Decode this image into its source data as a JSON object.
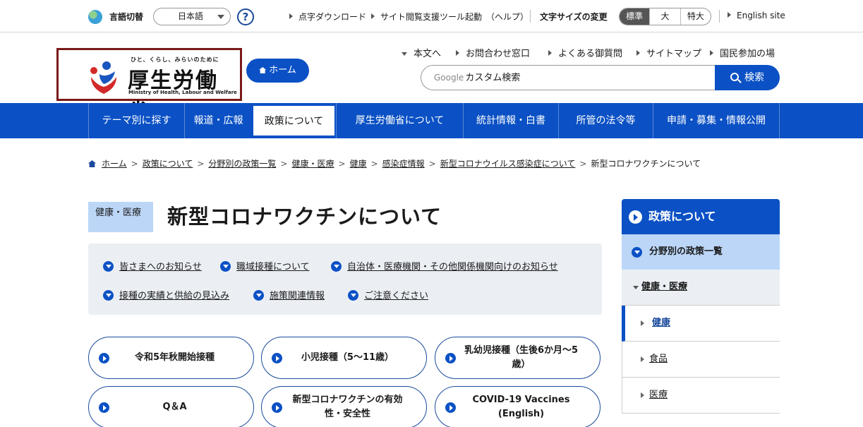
{
  "utility": {
    "lang_label": "言語切替",
    "lang_value": "日本語",
    "help": "?",
    "links": [
      "点字ダウンロード",
      "サイト閲覧支援ツール起動",
      "（ヘルプ）"
    ],
    "font_size_label": "文字サイズの変更",
    "font_sizes": [
      "標準",
      "大",
      "特大"
    ],
    "english": "English site"
  },
  "header": {
    "logo_tagline": "ひと、くらし、みらいのために",
    "logo_text": "厚生労働省",
    "logo_en": "Ministry of Health, Labour and Welfare",
    "home_button": "ホーム",
    "links": [
      "本文へ",
      "お問合わせ窓口",
      "よくある御質問",
      "サイトマップ",
      "国民参加の場"
    ],
    "search_prefix": "Google",
    "search_placeholder": "カスタム検索",
    "search_button": "検索"
  },
  "nav": [
    "テーマ別に探す",
    "報道・広報",
    "政策について",
    "厚生労働省について",
    "統計情報・白書",
    "所管の法令等",
    "申請・募集・情報公開"
  ],
  "breadcrumb": [
    "ホーム",
    "政策について",
    "分野別の政策一覧",
    "健康・医療",
    "健康",
    "感染症情報",
    "新型コロナウイルス感染症について",
    "新型コロナワクチンについて"
  ],
  "category_badge": "健康・医療",
  "title": "新型コロナワクチンについて",
  "anchors": [
    "皆さまへのお知らせ",
    "職域接種について",
    "自治体・医療機関・その他関係機関向けのお知らせ",
    "接種の実績と供給の見込み",
    "施策関連情報",
    "ご注意ください"
  ],
  "pills": [
    "令和5年秋開始接種",
    "小児接種（5～11歳）",
    "乳幼児接種（生後6か月～5歳）",
    "Q＆A",
    "新型コロナワクチンの有効性・安全性",
    "COVID-19 Vaccines (English)"
  ],
  "sidebar": {
    "heading": "政策について",
    "sub": "分野別の政策一覧",
    "sub2": "健康・医療",
    "items": [
      "健康",
      "食品",
      "医療"
    ]
  },
  "colors": {
    "primary": "#0b51c5",
    "light_blue": "#bcd6f7",
    "panel": "#ebeff4",
    "logo_border": "#7a1a1a"
  }
}
